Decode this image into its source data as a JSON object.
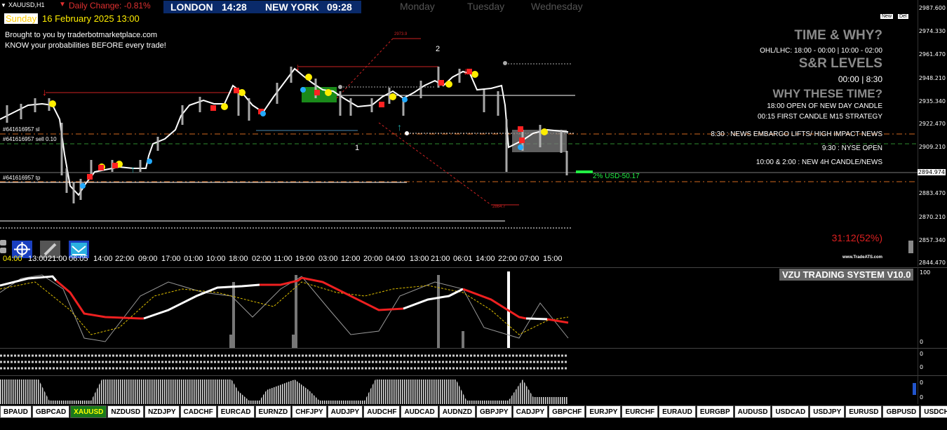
{
  "header": {
    "symbol_label": "XAUUSD,H1",
    "daily_change": "Daily Change: -0.81%",
    "date_day": "Sunday",
    "date_rest": "16 February 2025 13:00",
    "london_label": "LONDON",
    "london_time": "14:28",
    "ny_label": "NEW YORK",
    "ny_time": "09:28",
    "day_monday": "Monday",
    "day_tuesday": "Tuesday",
    "day_wednesday": "Wednesday",
    "promo_line1": "Brought to you by traderbotmarketplace.com",
    "promo_line2": "KNOW your probabilities BEFORE every trade!",
    "new_btn": "New",
    "del_btn": "Del"
  },
  "right_panel": {
    "title1": "TIME & WHY?",
    "ohl": "OHL/LHC: 18:00 - 00:00 | 10:00 - 02:00",
    "title2": "S&R LEVELS",
    "times": "00:00 | 8:30",
    "title3": "WHY THESE TIME?",
    "line1": "18:00 OPEN OF NEW DAY CANDLE",
    "line2": "00:15 FIRST CANDLE M15 STRATEGY",
    "line3": "8:30 : NEWS EMBARGO LIFTS/ HIGH IMPACT NEWS",
    "line4": "9:30 : NYSE OPEN",
    "line5": "10:00 & 2:00 : NEW 4H CANDLE/NEWS",
    "countdown": "31:12(52%)",
    "watermark": "www.TradeATS.com"
  },
  "chart_labels": {
    "sl": "#641616957 sl",
    "sell": "#641616957 sell 0.10",
    "tp": "#641616957 tp",
    "risk": "2% USD-50.17",
    "hi_price": "2973.9",
    "lo_price": "2864.7",
    "num1": "1",
    "num2": "2"
  },
  "price_scale": [
    "2987.600",
    "2974.330",
    "2961.470",
    "2948.210",
    "2935.340",
    "2922.470",
    "2909.210",
    "2894.974",
    "2883.470",
    "2870.210",
    "2857.340",
    "2844.470"
  ],
  "time_axis": [
    "04:00",
    "13:00",
    "21:00",
    "06:05",
    "14:00",
    "22:00",
    "09:00",
    "17:00",
    "01:00",
    "10:00",
    "18:00",
    "02:00",
    "11:00",
    "19:00",
    "03:00",
    "12:00",
    "20:00",
    "04:00",
    "13:00",
    "21:00",
    "06:01",
    "14:00",
    "22:00",
    "07:00",
    "15:00"
  ],
  "indicator": {
    "title": "VZU TRADING SYSTEM V10.0",
    "scale_top": "100",
    "scale_bottom": "0"
  },
  "sub_scales": {
    "a_top": "0",
    "a_bottom": "0",
    "b_top": "0",
    "b_bottom": "0"
  },
  "symbols": [
    "BPAUD",
    "GBPCAD",
    "XAUUSD",
    "NZDUSD",
    "NZDJPY",
    "CADCHF",
    "EURCAD",
    "EURNZD",
    "CHFJPY",
    "AUDJPY",
    "AUDCHF",
    "AUDCAD",
    "AUDNZD",
    "GBPJPY",
    "CADJPY",
    "GBPCHF",
    "EURJPY",
    "EURCHF",
    "EURAUD",
    "EURGBP",
    "AUDUSD",
    "USDCAD",
    "USDJPY",
    "EURUSD",
    "GBPUSD",
    "USDCHF"
  ],
  "active_symbol": "XAUUSD",
  "icons": [
    "crosshair-icon",
    "pencil-icon",
    "chart-trend-icon"
  ]
}
